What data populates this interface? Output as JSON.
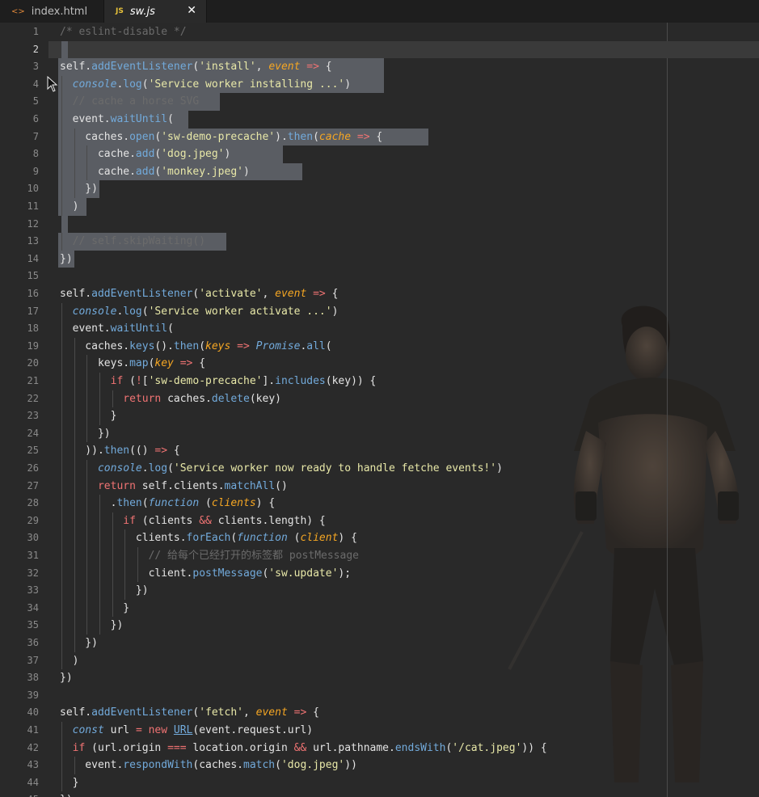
{
  "tabs": [
    {
      "label": "index.html",
      "icon": "html-icon",
      "glyph": "<>",
      "active": false
    },
    {
      "label": "sw.js",
      "icon": "js-icon",
      "glyph": "JS",
      "active": true,
      "close": "✕"
    }
  ],
  "colors": {
    "plain": "#e4e4e4",
    "comment": "#6b6b6b",
    "string": "#e8e8a8",
    "keyword": "#f07373",
    "param": "#f5a623",
    "method": "#72aadb",
    "builtin": "#72aadb",
    "operator": "#f07373",
    "selection": "#5a5d63"
  },
  "editor": {
    "current_line": 2,
    "lines": [
      {
        "n": "1",
        "t": [
          [
            "/* eslint-disable */",
            "comment"
          ]
        ]
      },
      {
        "n": "2",
        "t": []
      },
      {
        "n": "3",
        "t": [
          [
            "self.",
            "plain"
          ],
          [
            "addEventListener",
            "method"
          ],
          [
            "(",
            "plain"
          ],
          [
            "'install'",
            "string"
          ],
          [
            ", ",
            "plain"
          ],
          [
            "event",
            "param"
          ],
          [
            " => ",
            "operator"
          ],
          [
            "{",
            "plain"
          ]
        ]
      },
      {
        "n": "4",
        "t": [
          [
            "  ",
            "plain"
          ],
          [
            "console",
            "builtin"
          ],
          [
            ".",
            "plain"
          ],
          [
            "log",
            "method"
          ],
          [
            "(",
            "plain"
          ],
          [
            "'Service worker installing ...'",
            "string"
          ],
          [
            ")",
            "plain"
          ]
        ]
      },
      {
        "n": "5",
        "t": [
          [
            "  ",
            "plain"
          ],
          [
            "// cache a horse SVG",
            "comment"
          ]
        ]
      },
      {
        "n": "6",
        "t": [
          [
            "  event.",
            "plain"
          ],
          [
            "waitUntil",
            "method"
          ],
          [
            "(",
            "plain"
          ]
        ]
      },
      {
        "n": "7",
        "t": [
          [
            "    caches.",
            "plain"
          ],
          [
            "open",
            "method"
          ],
          [
            "(",
            "plain"
          ],
          [
            "'sw-demo-precache'",
            "string"
          ],
          [
            ").",
            "plain"
          ],
          [
            "then",
            "method"
          ],
          [
            "(",
            "plain"
          ],
          [
            "cache",
            "param"
          ],
          [
            " => ",
            "operator"
          ],
          [
            "{",
            "plain"
          ]
        ]
      },
      {
        "n": "8",
        "t": [
          [
            "      cache.",
            "plain"
          ],
          [
            "add",
            "method"
          ],
          [
            "(",
            "plain"
          ],
          [
            "'dog.jpeg'",
            "string"
          ],
          [
            ")",
            "plain"
          ]
        ]
      },
      {
        "n": "9",
        "t": [
          [
            "      cache.",
            "plain"
          ],
          [
            "add",
            "method"
          ],
          [
            "(",
            "plain"
          ],
          [
            "'monkey.jpeg'",
            "string"
          ],
          [
            ")",
            "plain"
          ]
        ]
      },
      {
        "n": "10",
        "t": [
          [
            "    })",
            "plain"
          ]
        ]
      },
      {
        "n": "11",
        "t": [
          [
            "  )",
            "plain"
          ]
        ]
      },
      {
        "n": "12",
        "t": []
      },
      {
        "n": "13",
        "t": [
          [
            "  ",
            "plain"
          ],
          [
            "// self.skipWaiting()",
            "comment"
          ]
        ]
      },
      {
        "n": "14",
        "t": [
          [
            "})",
            "plain"
          ]
        ]
      },
      {
        "n": "15",
        "t": []
      },
      {
        "n": "16",
        "t": [
          [
            "self.",
            "plain"
          ],
          [
            "addEventListener",
            "method"
          ],
          [
            "(",
            "plain"
          ],
          [
            "'activate'",
            "string"
          ],
          [
            ", ",
            "plain"
          ],
          [
            "event",
            "param"
          ],
          [
            " => ",
            "operator"
          ],
          [
            "{",
            "plain"
          ]
        ]
      },
      {
        "n": "17",
        "t": [
          [
            "  ",
            "plain"
          ],
          [
            "console",
            "builtin"
          ],
          [
            ".",
            "plain"
          ],
          [
            "log",
            "method"
          ],
          [
            "(",
            "plain"
          ],
          [
            "'Service worker activate ...'",
            "string"
          ],
          [
            ")",
            "plain"
          ]
        ]
      },
      {
        "n": "18",
        "t": [
          [
            "  event.",
            "plain"
          ],
          [
            "waitUntil",
            "method"
          ],
          [
            "(",
            "plain"
          ]
        ]
      },
      {
        "n": "19",
        "t": [
          [
            "    caches.",
            "plain"
          ],
          [
            "keys",
            "method"
          ],
          [
            "().",
            "plain"
          ],
          [
            "then",
            "method"
          ],
          [
            "(",
            "plain"
          ],
          [
            "keys",
            "param"
          ],
          [
            " => ",
            "operator"
          ],
          [
            "Promise",
            "builtin"
          ],
          [
            ".",
            "plain"
          ],
          [
            "all",
            "method"
          ],
          [
            "(",
            "plain"
          ]
        ]
      },
      {
        "n": "20",
        "t": [
          [
            "      keys.",
            "plain"
          ],
          [
            "map",
            "method"
          ],
          [
            "(",
            "plain"
          ],
          [
            "key",
            "param"
          ],
          [
            " => ",
            "operator"
          ],
          [
            "{",
            "plain"
          ]
        ]
      },
      {
        "n": "21",
        "t": [
          [
            "        ",
            "plain"
          ],
          [
            "if",
            "keyword"
          ],
          [
            " (",
            "plain"
          ],
          [
            "!",
            "operator"
          ],
          [
            "[",
            "plain"
          ],
          [
            "'sw-demo-precache'",
            "string"
          ],
          [
            "].",
            "plain"
          ],
          [
            "includes",
            "method"
          ],
          [
            "(key)) {",
            "plain"
          ]
        ]
      },
      {
        "n": "22",
        "t": [
          [
            "          ",
            "plain"
          ],
          [
            "return",
            "keyword"
          ],
          [
            " caches.",
            "plain"
          ],
          [
            "delete",
            "method"
          ],
          [
            "(key)",
            "plain"
          ]
        ]
      },
      {
        "n": "23",
        "t": [
          [
            "        }",
            "plain"
          ]
        ]
      },
      {
        "n": "24",
        "t": [
          [
            "      })",
            "plain"
          ]
        ]
      },
      {
        "n": "25",
        "t": [
          [
            "    )).",
            "plain"
          ],
          [
            "then",
            "method"
          ],
          [
            "(() ",
            "plain"
          ],
          [
            "=>",
            "operator"
          ],
          [
            " {",
            "plain"
          ]
        ]
      },
      {
        "n": "26",
        "t": [
          [
            "      ",
            "plain"
          ],
          [
            "console",
            "builtin"
          ],
          [
            ".",
            "plain"
          ],
          [
            "log",
            "method"
          ],
          [
            "(",
            "plain"
          ],
          [
            "'Service worker now ready to handle fetche events!'",
            "string"
          ],
          [
            ")",
            "plain"
          ]
        ]
      },
      {
        "n": "27",
        "t": [
          [
            "      ",
            "plain"
          ],
          [
            "return",
            "keyword"
          ],
          [
            " self.",
            "plain"
          ],
          [
            "clients",
            "plain"
          ],
          [
            ".",
            "plain"
          ],
          [
            "matchAll",
            "method"
          ],
          [
            "()",
            "plain"
          ]
        ]
      },
      {
        "n": "28",
        "t": [
          [
            "        .",
            "plain"
          ],
          [
            "then",
            "method"
          ],
          [
            "(",
            "plain"
          ],
          [
            "function",
            "builtin"
          ],
          [
            " (",
            "plain"
          ],
          [
            "clients",
            "param"
          ],
          [
            ") {",
            "plain"
          ]
        ]
      },
      {
        "n": "29",
        "t": [
          [
            "          ",
            "plain"
          ],
          [
            "if",
            "keyword"
          ],
          [
            " (clients ",
            "plain"
          ],
          [
            "&&",
            "operator"
          ],
          [
            " clients.length) {",
            "plain"
          ]
        ]
      },
      {
        "n": "30",
        "t": [
          [
            "            clients.",
            "plain"
          ],
          [
            "forEach",
            "method"
          ],
          [
            "(",
            "plain"
          ],
          [
            "function",
            "builtin"
          ],
          [
            " (",
            "plain"
          ],
          [
            "client",
            "param"
          ],
          [
            ") {",
            "plain"
          ]
        ]
      },
      {
        "n": "31",
        "t": [
          [
            "              ",
            "plain"
          ],
          [
            "// 给每个已经打开的标签都 postMessage",
            "comment"
          ]
        ]
      },
      {
        "n": "32",
        "t": [
          [
            "              client.",
            "plain"
          ],
          [
            "postMessage",
            "method"
          ],
          [
            "(",
            "plain"
          ],
          [
            "'sw.update'",
            "string"
          ],
          [
            ");",
            "plain"
          ]
        ]
      },
      {
        "n": "33",
        "t": [
          [
            "            })",
            "plain"
          ]
        ]
      },
      {
        "n": "34",
        "t": [
          [
            "          }",
            "plain"
          ]
        ]
      },
      {
        "n": "35",
        "t": [
          [
            "        })",
            "plain"
          ]
        ]
      },
      {
        "n": "36",
        "t": [
          [
            "    })",
            "plain"
          ]
        ]
      },
      {
        "n": "37",
        "t": [
          [
            "  )",
            "plain"
          ]
        ]
      },
      {
        "n": "38",
        "t": [
          [
            "})",
            "plain"
          ]
        ]
      },
      {
        "n": "39",
        "t": []
      },
      {
        "n": "40",
        "t": [
          [
            "self.",
            "plain"
          ],
          [
            "addEventListener",
            "method"
          ],
          [
            "(",
            "plain"
          ],
          [
            "'fetch'",
            "string"
          ],
          [
            ", ",
            "plain"
          ],
          [
            "event",
            "param"
          ],
          [
            " => ",
            "operator"
          ],
          [
            "{",
            "plain"
          ]
        ]
      },
      {
        "n": "41",
        "t": [
          [
            "  ",
            "plain"
          ],
          [
            "const",
            "builtin"
          ],
          [
            " url ",
            "plain"
          ],
          [
            "=",
            "operator"
          ],
          [
            " ",
            "plain"
          ],
          [
            "new",
            "keyword"
          ],
          [
            " ",
            "plain"
          ],
          [
            "URL",
            "builtin"
          ],
          [
            "(event.request.url)",
            "plain"
          ]
        ]
      },
      {
        "n": "42",
        "t": [
          [
            "  ",
            "plain"
          ],
          [
            "if",
            "keyword"
          ],
          [
            " (url.origin ",
            "plain"
          ],
          [
            "===",
            "operator"
          ],
          [
            " location.origin ",
            "plain"
          ],
          [
            "&&",
            "operator"
          ],
          [
            " url.pathname.",
            "plain"
          ],
          [
            "endsWith",
            "method"
          ],
          [
            "(",
            "plain"
          ],
          [
            "'/cat.jpeg'",
            "string"
          ],
          [
            ")) {",
            "plain"
          ]
        ]
      },
      {
        "n": "43",
        "t": [
          [
            "    event.",
            "plain"
          ],
          [
            "respondWith",
            "method"
          ],
          [
            "(caches.",
            "plain"
          ],
          [
            "match",
            "method"
          ],
          [
            "(",
            "plain"
          ],
          [
            "'dog.jpeg'",
            "string"
          ],
          [
            "))",
            "plain"
          ]
        ]
      },
      {
        "n": "44",
        "t": [
          [
            "  }",
            "plain"
          ]
        ]
      },
      {
        "n": "45",
        "t": [
          [
            "})",
            "plain"
          ]
        ]
      }
    ]
  }
}
